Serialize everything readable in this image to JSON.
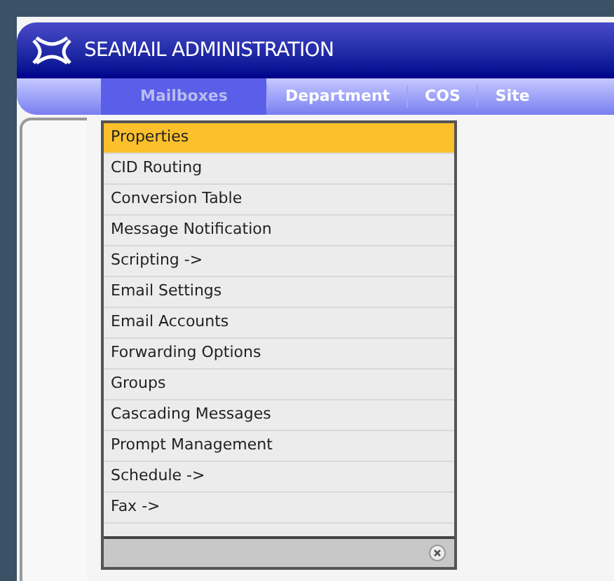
{
  "window": {
    "title": "SEAMAIL ADMINISTRATION"
  },
  "tabs": [
    {
      "label": "Mailboxes",
      "selected": true
    },
    {
      "label": "Department",
      "selected": false
    },
    {
      "label": "COS",
      "selected": false
    },
    {
      "label": "Site",
      "selected": false
    }
  ],
  "menu": {
    "items": [
      {
        "label": "Properties",
        "selected": true
      },
      {
        "label": "CID Routing",
        "selected": false
      },
      {
        "label": "Conversion Table",
        "selected": false
      },
      {
        "label": "Message Notification",
        "selected": false
      },
      {
        "label": "Scripting ->",
        "selected": false
      },
      {
        "label": "Email Settings",
        "selected": false
      },
      {
        "label": "Email Accounts",
        "selected": false
      },
      {
        "label": "Forwarding Options",
        "selected": false
      },
      {
        "label": "Groups",
        "selected": false
      },
      {
        "label": "Cascading Messages",
        "selected": false
      },
      {
        "label": "Prompt Management",
        "selected": false
      },
      {
        "label": "Schedule ->",
        "selected": false
      },
      {
        "label": "Fax ->",
        "selected": false
      }
    ]
  }
}
